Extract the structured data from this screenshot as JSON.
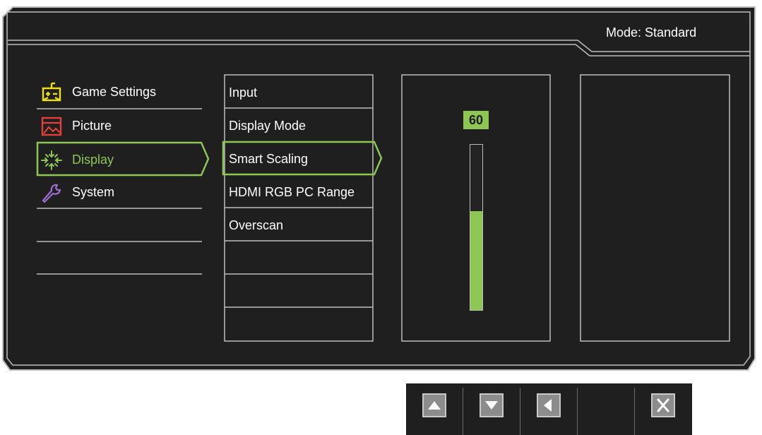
{
  "header": {
    "mode_label": "Mode: Standard"
  },
  "menu_level1": [
    {
      "label": "Game Settings",
      "icon": "game-settings-icon",
      "active": false
    },
    {
      "label": "Picture",
      "icon": "picture-icon",
      "active": false
    },
    {
      "label": "Display",
      "icon": "display-icon",
      "active": true
    },
    {
      "label": "System",
      "icon": "system-wrench-icon",
      "active": false
    },
    {
      "label": ""
    },
    {
      "label": ""
    },
    {
      "label": ""
    }
  ],
  "menu_level2": [
    {
      "label": "Input",
      "active": false
    },
    {
      "label": "Display Mode",
      "active": false
    },
    {
      "label": "Smart Scaling",
      "active": true
    },
    {
      "label": "HDMI RGB PC Range",
      "active": false
    },
    {
      "label": "Overscan",
      "active": false
    },
    {
      "label": ""
    },
    {
      "label": ""
    },
    {
      "label": ""
    }
  ],
  "slider": {
    "value": "60",
    "fraction": 0.6
  },
  "buttons": [
    {
      "icon": "up-arrow-icon"
    },
    {
      "icon": "down-arrow-icon"
    },
    {
      "icon": "left-arrow-icon"
    },
    {
      "icon": ""
    },
    {
      "icon": "close-icon"
    }
  ],
  "colors": {
    "accent": "#8ec653",
    "background": "#1f1f1f",
    "border": "#bdbdbd",
    "game_icon": "#f0e017",
    "picture_icon": "#e0403a",
    "system_icon": "#9b6fd0"
  }
}
